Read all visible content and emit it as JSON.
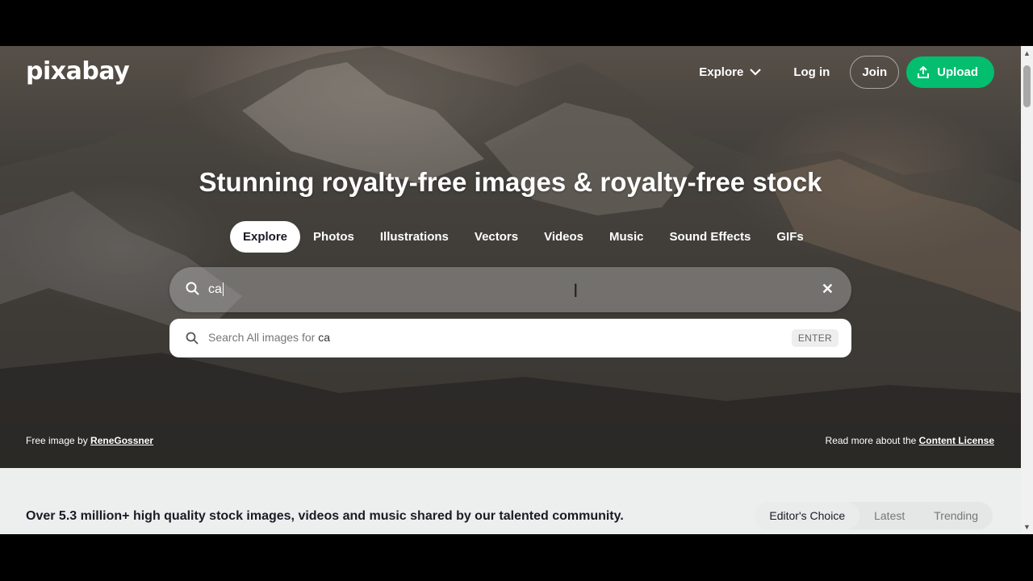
{
  "header": {
    "logo": "pixabay",
    "nav": {
      "explore": "Explore",
      "login": "Log in",
      "join": "Join",
      "upload": "Upload"
    }
  },
  "hero": {
    "headline": "Stunning royalty-free images & royalty-free stock",
    "tabs": [
      {
        "label": "Explore",
        "active": true
      },
      {
        "label": "Photos"
      },
      {
        "label": "Illustrations"
      },
      {
        "label": "Vectors"
      },
      {
        "label": "Videos"
      },
      {
        "label": "Music"
      },
      {
        "label": "Sound Effects"
      },
      {
        "label": "GIFs"
      }
    ],
    "search": {
      "value": "ca",
      "clear_icon": "close-icon"
    },
    "suggestion": {
      "prefix": "Search All images for",
      "term": "ca",
      "key_hint": "ENTER"
    },
    "credit": {
      "prefix": "Free image by",
      "author": "ReneGossner"
    },
    "license": {
      "prefix": "Read more about the",
      "link": "Content License"
    }
  },
  "below": {
    "tagline": "Over 5.3 million+ high quality stock images, videos and music shared by our talented community.",
    "filters": [
      {
        "label": "Editor's Choice",
        "active": true
      },
      {
        "label": "Latest"
      },
      {
        "label": "Trending"
      }
    ]
  },
  "colors": {
    "brand_green": "#02be6e",
    "text_dark": "#191b26"
  }
}
